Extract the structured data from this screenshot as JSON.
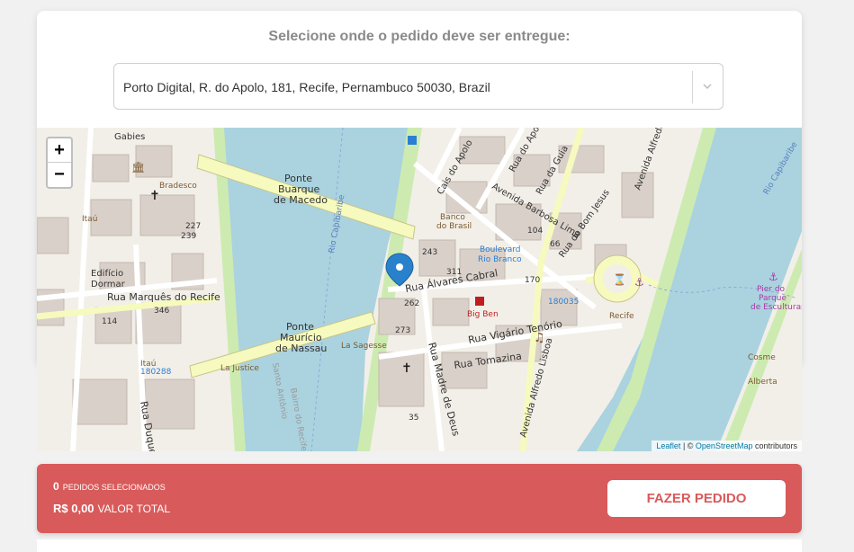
{
  "card": {
    "title": "Selecione onde o pedido deve ser entregue:",
    "address_value": "Porto Digital, R. do Apolo, 181, Recife, Pernambuco 50030, Brazil"
  },
  "map": {
    "zoom_in": "+",
    "zoom_out": "−",
    "attribution_leaflet": "Leaflet",
    "attribution_sep": " | © ",
    "attribution_osm": "OpenStreetMap",
    "attribution_suffix": " contributors",
    "labels": {
      "gabies": "Gabies",
      "bradesco": "Bradesco",
      "itau1": "Itaú",
      "ponte_buarque_1": "Ponte",
      "ponte_buarque_2": "Buarque",
      "ponte_buarque_3": "de Macedo",
      "rio_capibaribe_1": "Rio Capibaribe",
      "rio_capibaribe_2": "Rio Capibaribe",
      "cais_apolo": "Cais do Apolo",
      "rua_apolo": "Rua do Apolo",
      "rua_guia": "Rua da Guia",
      "av_barbosa": "Avenida Barbosa Lima",
      "rua_bom_jesus": "Rua do Bom Jesus",
      "av_alfredo": "Avenida Alfredo",
      "av_alfredo_lisboa": "Avenida Alfredo Lisboa",
      "banco_1": "Banco",
      "banco_2": "do Brasil",
      "boulevard_1": "Boulevard",
      "boulevard_2": "Rio Branco",
      "edificio_1": "Edifício",
      "edificio_2": "Dormar",
      "rua_marques": "Rua Marquês do Recife",
      "rua_alvares": "Rua Álvares Cabral",
      "big_ben": "Big Ben",
      "bus_180035": "180035",
      "ponte_mauricio_1": "Ponte",
      "ponte_mauricio_2": "Maurício",
      "ponte_mauricio_3": "de Nassau",
      "la_sagesse": "La Sagesse",
      "rua_vigario": "Rua Vigário Tenório",
      "rua_tomazina": "Rua Tomazina",
      "rua_madre": "Rua Madre de Deus",
      "itau2": "Itaú",
      "bus_180288": "180288",
      "la_justice": "La Justice",
      "rua_duque": "Rua Duque",
      "santo_antonio": "Santo Antônio",
      "bairro_recife": "Bairro do Recife",
      "recife": "Recife",
      "pier_1": "Pier do",
      "pier_2": "Parque",
      "pier_3": "de Esculturas",
      "cosme": "Cosme",
      "alberta": "Alberta",
      "n227": "227",
      "n239": "239",
      "n243": "243",
      "n311": "311",
      "n262": "262",
      "n273": "273",
      "n35": "35",
      "n104": "104",
      "n66": "66",
      "n170": "170",
      "n114": "114",
      "n346": "346"
    }
  },
  "footer": {
    "count": "0",
    "count_label": "PEDIDOS SELECIONADOS",
    "total": "R$ 0,00",
    "total_label": "VALOR TOTAL",
    "order_button": "FAZER PEDIDO"
  }
}
